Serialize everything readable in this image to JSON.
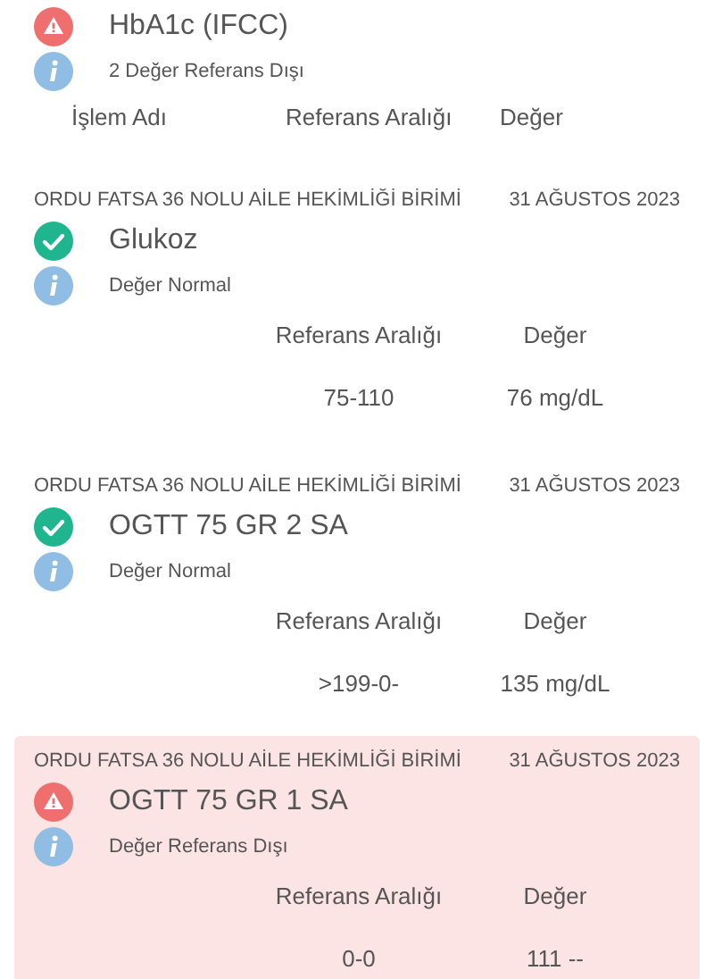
{
  "summary": {
    "kind": "abnormal",
    "title": "HbA1c (IFCC)",
    "note": "2 Değer Referans Dışı",
    "columns": [
      "İşlem Adı",
      "Referans Aralığı",
      "Değer"
    ]
  },
  "results": [
    {
      "clinic": "ORDU FATSA 36 NOLU AİLE HEKİMLİĞİ BİRİMİ",
      "date": "31 AĞUSTOS 2023",
      "kind": "normal",
      "test": "Glukoz",
      "note": "Değer Normal",
      "columns": [
        "Referans Aralığı",
        "Değer"
      ],
      "reference": "75-110",
      "value": "76 mg/dL"
    },
    {
      "clinic": "ORDU FATSA 36 NOLU AİLE HEKİMLİĞİ BİRİMİ",
      "date": "31 AĞUSTOS 2023",
      "kind": "normal",
      "test": "OGTT 75 GR 2 SA",
      "note": "Değer Normal",
      "columns": [
        "Referans Aralığı",
        "Değer"
      ],
      "reference": ">199-0-",
      "value": "135 mg/dL"
    },
    {
      "clinic": "ORDU FATSA 36 NOLU AİLE HEKİMLİĞİ BİRİMİ",
      "date": "31 AĞUSTOS 2023",
      "kind": "abnormal",
      "test": "OGTT 75 GR 1 SA",
      "note": "Değer Referans Dışı",
      "columns": [
        "Referans Aralığı",
        "Değer"
      ],
      "reference": "0-0",
      "value": "111 --"
    }
  ]
}
